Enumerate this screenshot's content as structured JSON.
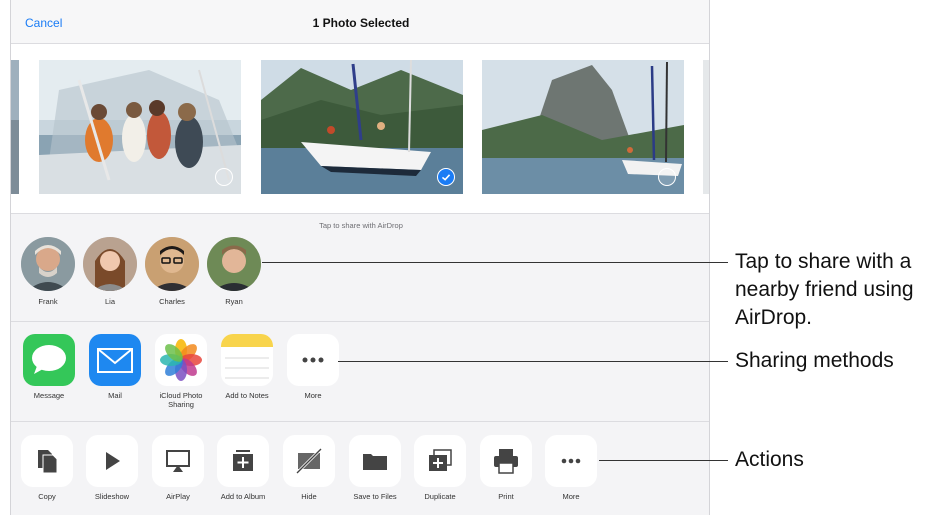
{
  "header": {
    "cancel_label": "Cancel",
    "title": "1 Photo Selected"
  },
  "photos": [
    {
      "name": "boat-party",
      "selected": false
    },
    {
      "name": "sailboat-bay",
      "selected": true
    },
    {
      "name": "sailboat-mountain",
      "selected": false
    }
  ],
  "airdrop": {
    "hint": "Tap to share with AirDrop",
    "people": [
      {
        "name": "Frank"
      },
      {
        "name": "Lia"
      },
      {
        "name": "Charles"
      },
      {
        "name": "Ryan"
      }
    ]
  },
  "share_apps": [
    {
      "label": "Message",
      "icon": "message-icon"
    },
    {
      "label": "Mail",
      "icon": "mail-icon"
    },
    {
      "label": "iCloud Photo Sharing",
      "icon": "photos-icon"
    },
    {
      "label": "Add to Notes",
      "icon": "notes-icon"
    },
    {
      "label": "More",
      "icon": "more-icon"
    }
  ],
  "actions": [
    {
      "label": "Copy",
      "icon": "copy-icon"
    },
    {
      "label": "Slideshow",
      "icon": "play-icon"
    },
    {
      "label": "AirPlay",
      "icon": "airplay-icon"
    },
    {
      "label": "Add to Album",
      "icon": "add-album-icon"
    },
    {
      "label": "Hide",
      "icon": "hide-icon"
    },
    {
      "label": "Save to Files",
      "icon": "folder-icon"
    },
    {
      "label": "Duplicate",
      "icon": "duplicate-icon"
    },
    {
      "label": "Print",
      "icon": "printer-icon"
    },
    {
      "label": "More",
      "icon": "more-icon"
    }
  ],
  "callouts": {
    "airdrop": "Tap to share with a nearby friend using AirDrop.",
    "sharing": "Sharing methods",
    "actions": "Actions"
  },
  "colors": {
    "accent": "#1a7cf5",
    "message_green": "#34c759",
    "mail_blue": "#1e88f0",
    "notes_yellow": "#f8d44c"
  }
}
